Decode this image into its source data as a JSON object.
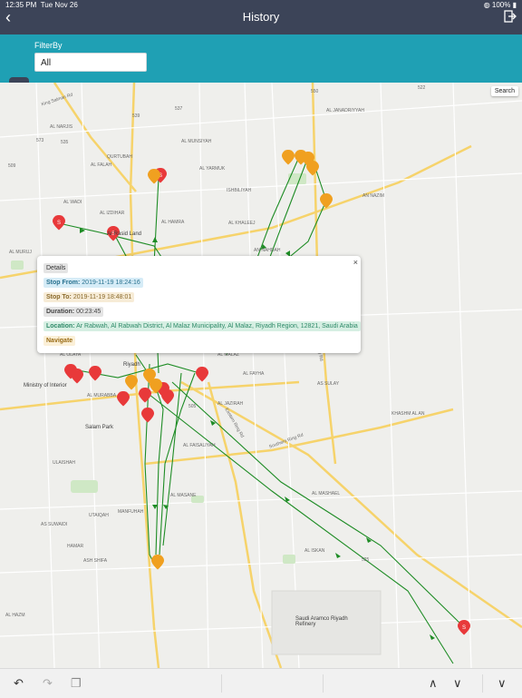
{
  "status": {
    "time": "12:35 PM",
    "date": "Tue Nov 26",
    "battery": "100%"
  },
  "nav": {
    "title": "History"
  },
  "filter": {
    "label": "FilterBy",
    "value": "All"
  },
  "map": {
    "search_label": "Search",
    "labels": [
      {
        "key": "king_salman",
        "text": "King Salman Rd"
      },
      {
        "key": "narjis",
        "text": "AL NARJIS"
      },
      {
        "key": "qurtubah",
        "text": "QURTUBAH"
      },
      {
        "key": "munsiyah",
        "text": "AL MUNSIYAH"
      },
      {
        "key": "yarmuk",
        "text": "AL YARMUK"
      },
      {
        "key": "ishbiliyah",
        "text": "ISHBILIYAH"
      },
      {
        "key": "janadriyyah",
        "text": "AL JANADRIYYAH"
      },
      {
        "key": "nazim",
        "text": "AN NAZIM"
      },
      {
        "key": "falah",
        "text": "AL FALAH"
      },
      {
        "key": "izdihar",
        "text": "AL IZDIHAR"
      },
      {
        "key": "wadi",
        "text": "AL WADI"
      },
      {
        "key": "hamra",
        "text": "AL HAMRA"
      },
      {
        "key": "khaleej",
        "text": "AL KHALEEJ"
      },
      {
        "key": "nahdah",
        "text": "AN NAHDAH"
      },
      {
        "key": "murujj",
        "text": "AL MURUJ"
      },
      {
        "key": "arrasid",
        "text": "Ar Rasid Land"
      },
      {
        "key": "riyadh",
        "text": "Riyadh"
      },
      {
        "key": "ministry",
        "text": "Ministry of Interior"
      },
      {
        "key": "olaya",
        "text": "AL OLAYA"
      },
      {
        "key": "malaz",
        "text": "AL MALAZ"
      },
      {
        "key": "fayha",
        "text": "AL FAYHA"
      },
      {
        "key": "sulay",
        "text": "AS SULAY"
      },
      {
        "key": "jazirah",
        "text": "AL JAZIRAH"
      },
      {
        "key": "murabba",
        "text": "AL MURABBA"
      },
      {
        "key": "salam",
        "text": "Salam Park"
      },
      {
        "key": "ulaishah",
        "text": "ULAISHAH"
      },
      {
        "key": "suwaidi",
        "text": "AS SUWAIDI"
      },
      {
        "key": "utaiqah",
        "text": "UTAIQAH"
      },
      {
        "key": "manfuhah",
        "text": "MANFUHAH"
      },
      {
        "key": "faisaliyah",
        "text": "AL FAISALIYAH"
      },
      {
        "key": "masane",
        "text": "AL MASANE"
      },
      {
        "key": "hamar",
        "text": "HAMAR"
      },
      {
        "key": "ashifa",
        "text": "ASH SHIFA"
      },
      {
        "key": "mashael",
        "text": "AL MASHAEL"
      },
      {
        "key": "iskan",
        "text": "AL ISKAN"
      },
      {
        "key": "khashm",
        "text": "KHASHM AL AN"
      },
      {
        "key": "hazm",
        "text": "AL HAZM"
      },
      {
        "key": "aramco",
        "text": "Saudi Aramco Riyadh Refinery"
      },
      {
        "key": "southern_ring",
        "text": "Southern Ring Rd"
      },
      {
        "key": "eastern_ring",
        "text": "Eastern Ring Rd"
      },
      {
        "key": "second_ring",
        "text": "2nd Ring Rd"
      },
      {
        "key": "rd_573",
        "text": "573"
      },
      {
        "key": "rd_539",
        "text": "539"
      },
      {
        "key": "rd_537",
        "text": "537"
      },
      {
        "key": "rd_535",
        "text": "535"
      },
      {
        "key": "rd_509",
        "text": "509"
      },
      {
        "key": "rd_550",
        "text": "550"
      },
      {
        "key": "rd_522",
        "text": "522"
      },
      {
        "key": "rd_505",
        "text": "505"
      },
      {
        "key": "rd_525",
        "text": "525"
      }
    ]
  },
  "popup": {
    "title": "Details",
    "stop_from_label": "Stop From:",
    "stop_from_value": "2019-11-19 18:24:16",
    "stop_to_label": "Stop To:",
    "stop_to_value": "2019-11-19 18:48:01",
    "duration_label": "Duration:",
    "duration_value": "00:23:45",
    "location_label": "Location:",
    "location_value": "Ar Rabwah, Al Rabwah District, Al Malaz Municipality, Al Malaz, Riyadh Region, 12821, Saudi Arabia",
    "navigate_label": "Navigate",
    "close_glyph": "×"
  },
  "toolbar": {
    "undo": "↶",
    "redo": "↷",
    "copy": "❐",
    "up": "∧",
    "down": "∨",
    "collapse": "∨"
  },
  "colors": {
    "navbar": "#3c4458",
    "filterbar": "#1fa0b4",
    "route": "#1e8c25",
    "stop_marker": "#e8393a",
    "idle_marker": "#f0a020"
  }
}
